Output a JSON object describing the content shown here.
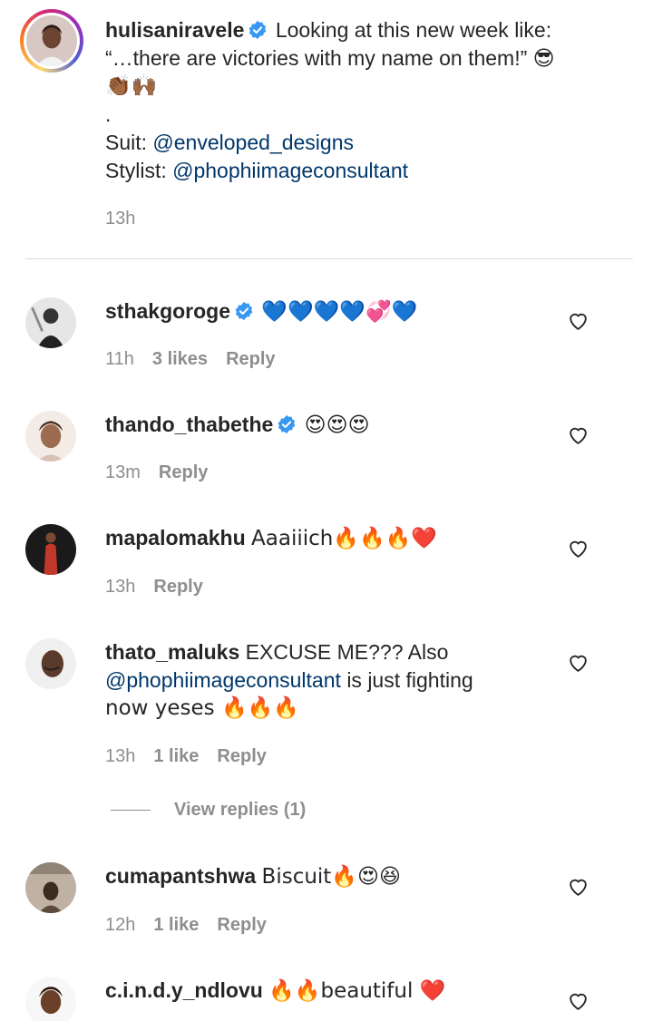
{
  "caption": {
    "username": "hulisaniravele",
    "text_line1": "Looking at this new week like:",
    "text_line2": "“…there are victories with my name on them!” 😎",
    "text_line3": "👏🏾🙌🏾",
    "text_line4": ".",
    "suit_label": "Suit:",
    "suit_mention": "@enveloped_designs",
    "stylist_label": "Stylist:",
    "stylist_mention": "@phophiimageconsultant",
    "time": "13h"
  },
  "comments": [
    {
      "username": "sthakgoroge",
      "verified": true,
      "text": "💙💙💙💙💞💙",
      "time": "11h",
      "likes": "3 likes",
      "reply": "Reply"
    },
    {
      "username": "thando_thabethe",
      "verified": true,
      "text": "😍😍😍",
      "time": "13m",
      "likes": "",
      "reply": "Reply"
    },
    {
      "username": "mapalomakhu",
      "verified": false,
      "text": "Aaaiiich🔥🔥🔥❤️",
      "time": "13h",
      "likes": "",
      "reply": "Reply"
    },
    {
      "username": "thato_maluks",
      "verified": false,
      "text_a": "EXCUSE ME??? Also",
      "mention": "@phophiimageconsultant",
      "text_b": "is just fighting",
      "text_c": "now yeses 🔥🔥🔥",
      "time": "13h",
      "likes": "1 like",
      "reply": "Reply",
      "view_replies": "View replies (1)"
    },
    {
      "username": "cumapantshwa",
      "verified": false,
      "text": "Biscuit🔥😍😆",
      "time": "12h",
      "likes": "1 like",
      "reply": "Reply"
    },
    {
      "username": "c.i.n.d.y_ndlovu",
      "verified": false,
      "text": "🔥🔥beautiful ❤️"
    }
  ],
  "icons": {
    "verified": "verified-badge-icon",
    "like": "heart-outline-icon"
  },
  "colors": {
    "verified_blue": "#3897f0",
    "mention": "#00376b",
    "meta_gray": "#8e8e8e"
  }
}
